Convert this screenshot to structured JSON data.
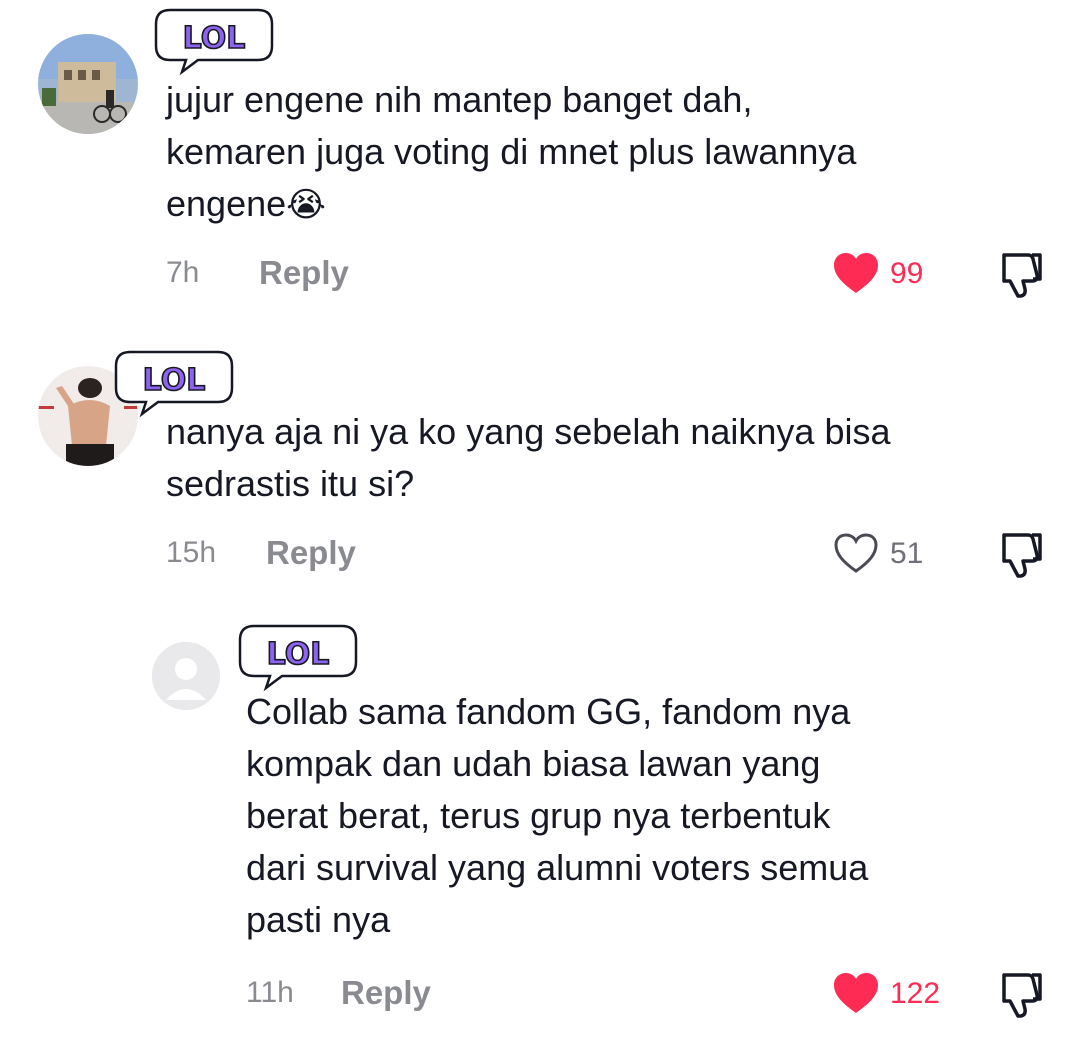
{
  "comments": [
    {
      "sticker": "LOL",
      "text": "jujur engene nih mantep banget dah,\nkemaren juga voting di mnet plus lawannya\nengene",
      "emoji": "😭",
      "time": "7h",
      "reply": "Reply",
      "likes": "99",
      "liked": true
    },
    {
      "sticker": "LOL",
      "text": "nanya aja ni ya ko yang sebelah naiknya bisa\nsedrastis itu si?",
      "time": "15h",
      "reply": "Reply",
      "likes": "51",
      "liked": false
    },
    {
      "sticker": "LOL",
      "text": "Collab sama fandom GG, fandom nya\nkompak dan udah biasa lawan yang\nberat berat, terus grup nya terbentuk\ndari survival yang alumni voters semua\npasti nya",
      "time": "11h",
      "reply": "Reply",
      "likes": "122",
      "liked": true
    }
  ],
  "colors": {
    "like": "#fe2c55",
    "meta": "#8a8b91",
    "text": "#161823",
    "sticker": "#8e63f0"
  },
  "icons": [
    "heart-icon",
    "dislike-icon",
    "lol-sticker"
  ]
}
